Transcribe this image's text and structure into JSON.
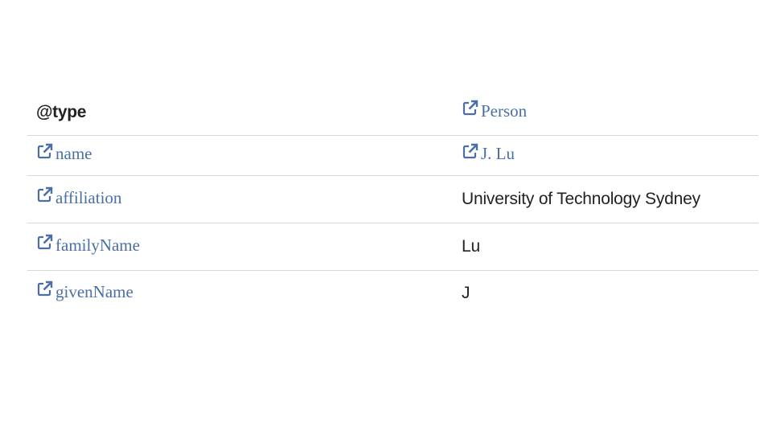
{
  "rows": [
    {
      "key": "@type",
      "key_is_link": false,
      "value": "Person",
      "value_is_link": true
    },
    {
      "key": "name",
      "key_is_link": true,
      "value": "J. Lu",
      "value_is_link": true
    },
    {
      "key": "affiliation",
      "key_is_link": true,
      "value": "University of Technology Sydney",
      "value_is_link": false
    },
    {
      "key": "familyName",
      "key_is_link": true,
      "value": "Lu",
      "value_is_link": false
    },
    {
      "key": "givenName",
      "key_is_link": true,
      "value": "J",
      "value_is_link": false
    }
  ],
  "icons": {
    "link": "external-link-icon"
  },
  "colors": {
    "link": "#4a6fa5",
    "text": "#222222",
    "divider": "#d9d9d9"
  }
}
